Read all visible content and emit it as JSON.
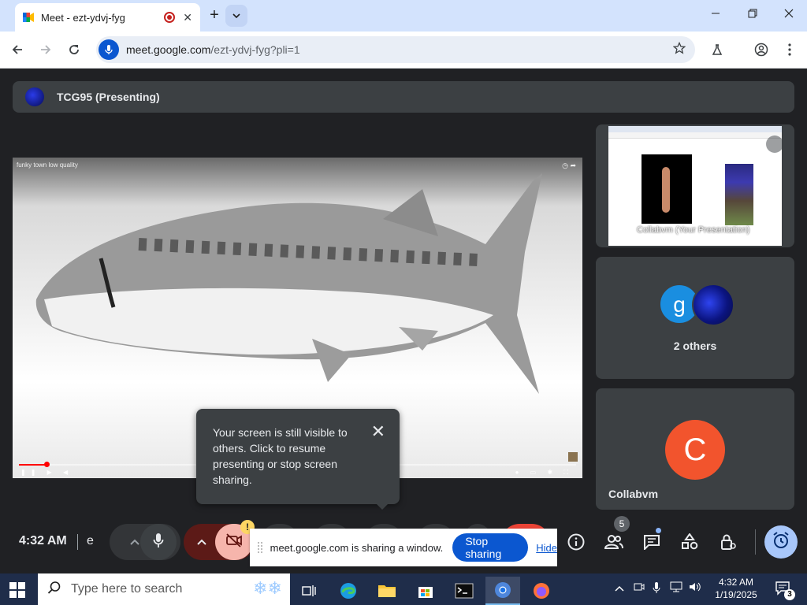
{
  "browser": {
    "tab_title": "Meet - ezt-ydvj-fyg",
    "url_host": "meet.google.com",
    "url_path": "/ezt-ydvj-fyg?pli=1"
  },
  "meet": {
    "presenter_label": "TCG95 (Presenting)",
    "video": {
      "title": "funky town low quality",
      "playback_progress_percent": 5
    },
    "tiles": [
      {
        "label": "Collabvm (Your Presentation)"
      },
      {
        "avatar_letter": "g",
        "label": "2 others"
      },
      {
        "avatar_letter": "C",
        "label": "Collabvm"
      }
    ],
    "popover": {
      "text": "Your screen is still visible to others. Click to resume presenting or stop screen sharing."
    },
    "controls": {
      "time": "4:32 AM",
      "meeting_code_visible": "e",
      "warning_badge": "!",
      "people_count": "5"
    },
    "share_bar": {
      "message": "meet.google.com is sharing a window.",
      "stop_label": "Stop sharing",
      "hide_label": "Hide"
    }
  },
  "taskbar": {
    "search_placeholder": "Type here to search",
    "time": "4:32 AM",
    "date": "1/19/2025",
    "notification_count": "3"
  },
  "colors": {
    "meet_bg": "#202124",
    "tile_bg": "#3c4043",
    "accent_blue": "#0b57d0",
    "stop_red": "#ea4335"
  }
}
